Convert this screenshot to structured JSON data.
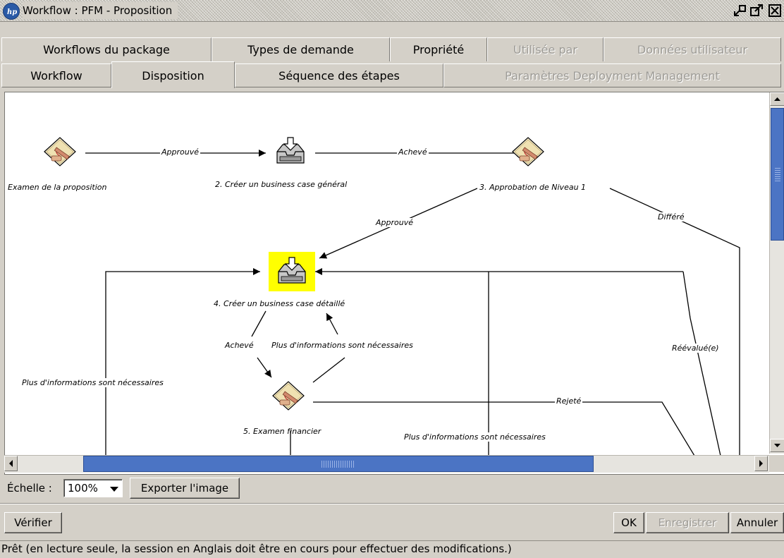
{
  "window": {
    "title": "Workflow : PFM - Proposition"
  },
  "tabs_row1": [
    {
      "label": "Workflows du package",
      "enabled": true
    },
    {
      "label": "Types de demande",
      "enabled": true
    },
    {
      "label": "Propriété",
      "enabled": true
    },
    {
      "label": "Utilisée par",
      "enabled": false
    },
    {
      "label": "Données utilisateur",
      "enabled": false
    }
  ],
  "tabs_row2": [
    {
      "label": "Workflow",
      "enabled": true
    },
    {
      "label": "Disposition",
      "enabled": true,
      "active": true
    },
    {
      "label": "Séquence des étapes",
      "enabled": true
    },
    {
      "label": "Paramètres Deployment Management",
      "enabled": false
    }
  ],
  "diagram": {
    "nodes": [
      {
        "id": "n1",
        "label": "Examen de la proposition",
        "icon": "approval-pen-icon",
        "highlighted": false
      },
      {
        "id": "n2",
        "label": "2. Créer un business case général",
        "icon": "inbox-tray-icon",
        "highlighted": false
      },
      {
        "id": "n3",
        "label": "3. Approbation de Niveau 1",
        "icon": "approval-pen-icon",
        "highlighted": false
      },
      {
        "id": "n4",
        "label": "4. Créer un business case détaillé",
        "icon": "inbox-tray-icon",
        "highlighted": true
      },
      {
        "id": "n5",
        "label": "5. Examen financier",
        "icon": "approval-pen-icon",
        "highlighted": false
      }
    ],
    "edge_labels": {
      "n1_n2": "Approuvé",
      "n2_n3": "Achevé",
      "n3_n4": "Approuvé",
      "n3_deferred": "Différé",
      "n4_n5": "Achevé",
      "n5_n4": "Plus d'informations sont nécessaires",
      "left_more_info": "Plus d'informations sont nécessaires",
      "n5_rejected": "Rejeté",
      "bottom_more_info": "Plus d'informations sont nécessaires",
      "reevaluated": "Réévalué(e)"
    },
    "highlight_color": "#ffff00"
  },
  "controls": {
    "scale_label": "Échelle :",
    "scale_value": "100%",
    "export_button": "Exporter l'image",
    "verify_button": "Vérifier",
    "ok_button": "OK",
    "save_button": "Enregistrer",
    "cancel_button": "Annuler"
  },
  "status_bar": {
    "text": "Prêt (en lecture seule, la session en Anglais doit être en cours pour effectuer des modifications.)"
  }
}
